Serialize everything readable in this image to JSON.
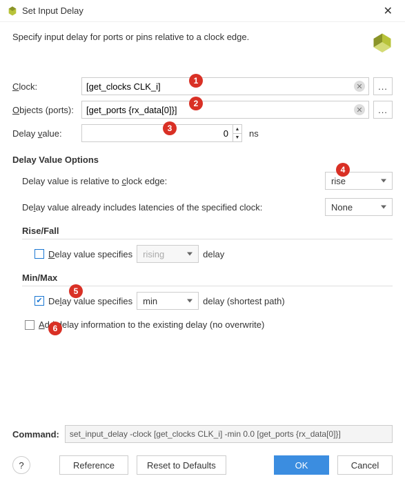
{
  "title": "Set Input Delay",
  "description": "Specify input delay for ports or pins relative to a clock edge.",
  "form": {
    "clock_label": "Clock:",
    "clock_value": "[get_clocks CLK_i]",
    "objects_label": "Objects (ports):",
    "objects_value": "[get_ports {rx_data[0]}]",
    "delay_label_pre": "Delay ",
    "delay_label_u": "v",
    "delay_label_post": "alue:",
    "delay_value": "0",
    "delay_unit": "ns",
    "more": "..."
  },
  "options": {
    "heading": "Delay Value Options",
    "relative_pre": "Delay value is relative to ",
    "relative_u": "c",
    "relative_post": "lock edge:",
    "relative_value": "rise",
    "latency_pre": "De",
    "latency_u": "l",
    "latency_post": "ay value already includes latencies of the specified clock:",
    "latency_value": "None"
  },
  "risefall": {
    "heading": "Rise/Fall",
    "spec_u": "D",
    "spec_post": "elay value specifies",
    "select_value": "rising",
    "trailing": "delay",
    "checked": false
  },
  "minmax": {
    "heading": "Min/Max",
    "spec_pre": "De",
    "spec_u": "l",
    "spec_post": "ay value specifies",
    "select_value": "min",
    "trailing": "delay (shortest path)",
    "checked": true
  },
  "add_delay": {
    "u": "A",
    "post": "dd delay information to the existing delay (no overwrite)",
    "checked": false
  },
  "command": {
    "label": "Command:",
    "value": "set_input_delay -clock [get_clocks CLK_i] -min 0.0 [get_ports {rx_data[0]}]"
  },
  "buttons": {
    "help": "?",
    "reference": "Reference",
    "reset": "Reset to Defaults",
    "ok": "OK",
    "cancel": "Cancel"
  },
  "markers": {
    "m1": "1",
    "m2": "2",
    "m3": "3",
    "m4": "4",
    "m5": "5",
    "m6": "6"
  }
}
